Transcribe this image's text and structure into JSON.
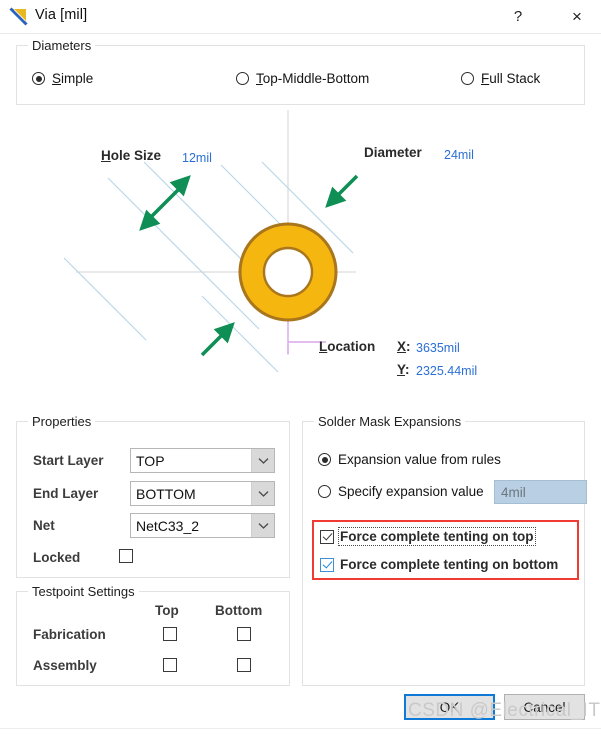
{
  "window": {
    "title": "Via [mil]",
    "icon": "via-icon",
    "help_label": "?",
    "close_label": "×"
  },
  "diameters": {
    "group_title": "Diameters",
    "options": [
      {
        "label": "Simple",
        "accel": "S",
        "selected": true
      },
      {
        "label": "Top-Middle-Bottom",
        "accel": "T",
        "selected": false
      },
      {
        "label": "Full Stack",
        "accel": "F",
        "selected": false
      }
    ]
  },
  "diagram": {
    "hole_size_label": "Hole Size",
    "hole_size_accel": "H",
    "hole_size_value": "12mil",
    "diameter_label": "Diameter",
    "diameter_value": "24mil",
    "location_label": "Location",
    "location_accel": "L",
    "location_x_label": "X:",
    "location_x_value": "3635mil",
    "location_y_label": "Y:",
    "location_y_value": "2325.44mil",
    "colors": {
      "pad_fill": "#f5b610",
      "pad_outline": "#a9761c",
      "guide_line": "#b6d6e8",
      "arrow": "#0f8f55",
      "crosshair": "#cfcfcf",
      "location_line": "#d9a8ea",
      "value_text": "#2b6fd4"
    }
  },
  "properties": {
    "group_title": "Properties",
    "rows": [
      {
        "label": "Start Layer",
        "value": "TOP"
      },
      {
        "label": "End Layer",
        "value": "BOTTOM"
      },
      {
        "label": "Net",
        "value": "NetC33_2"
      }
    ],
    "locked_label": "Locked",
    "locked_checked": false
  },
  "solder_mask": {
    "group_title": "Solder Mask Expansions",
    "options": [
      {
        "label": "Expansion value from rules",
        "selected": true
      },
      {
        "label": "Specify expansion value",
        "selected": false
      }
    ],
    "expansion_value": "4mil",
    "tenting": [
      {
        "label": "Force complete tenting on top",
        "checked": true,
        "focused": true,
        "style": "dark"
      },
      {
        "label": "Force complete tenting on bottom",
        "checked": true,
        "focused": false,
        "style": "blue"
      }
    ],
    "highlight_color": "#ef3b33"
  },
  "testpoint": {
    "group_title": "Testpoint Settings",
    "columns": [
      "Top",
      "Bottom"
    ],
    "rows": [
      {
        "label": "Fabrication",
        "top_checked": false,
        "bottom_checked": false
      },
      {
        "label": "Assembly",
        "top_checked": false,
        "bottom_checked": false
      }
    ]
  },
  "footer": {
    "ok_label": "OK",
    "cancel_label": "Cancel"
  },
  "watermark": "CSDN @Electrical_IT"
}
